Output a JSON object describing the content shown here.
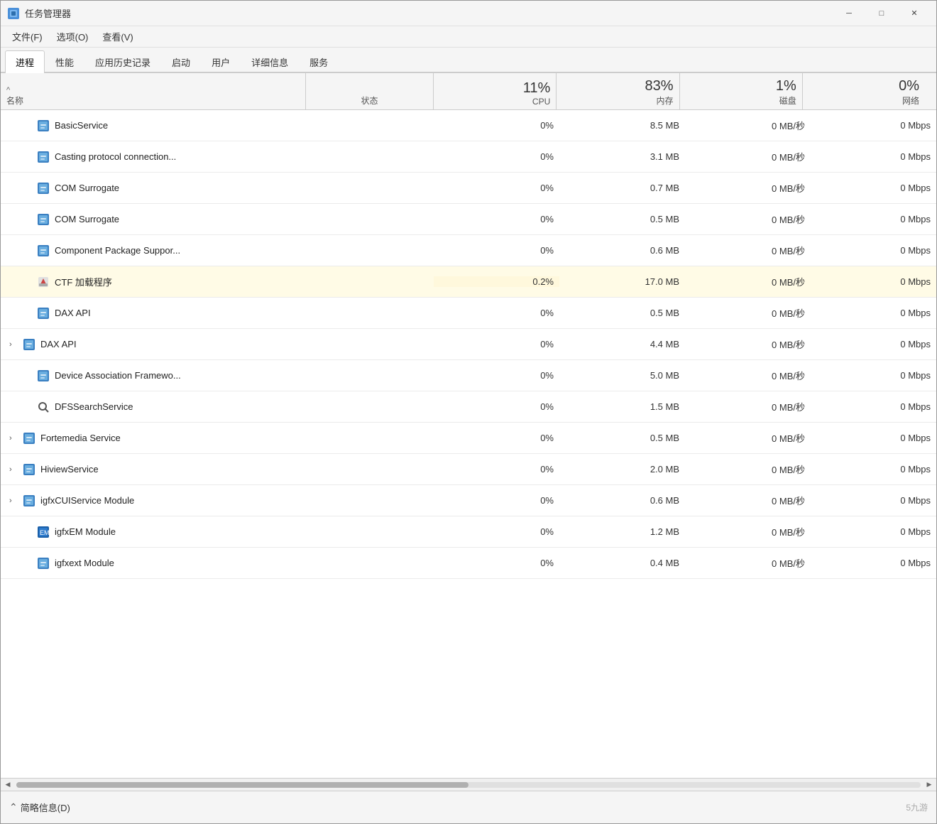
{
  "window": {
    "title": "任务管理器",
    "icon": "⚙"
  },
  "titlebar": {
    "title": "任务管理器",
    "minimize": "─",
    "maximize": "□",
    "close": "✕"
  },
  "menubar": {
    "items": [
      {
        "label": "文件(F)"
      },
      {
        "label": "选项(O)"
      },
      {
        "label": "查看(V)"
      }
    ]
  },
  "tabs": [
    {
      "label": "进程",
      "active": true
    },
    {
      "label": "性能",
      "active": false
    },
    {
      "label": "应用历史记录",
      "active": false
    },
    {
      "label": "启动",
      "active": false
    },
    {
      "label": "用户",
      "active": false
    },
    {
      "label": "详细信息",
      "active": false
    },
    {
      "label": "服务",
      "active": false
    }
  ],
  "table": {
    "headers": {
      "name_sort": "^",
      "name": "名称",
      "status": "状态",
      "cpu_pct": "11%",
      "cpu_label": "CPU",
      "mem_pct": "83%",
      "mem_label": "内存",
      "disk_pct": "1%",
      "disk_label": "磁盘",
      "net_pct": "0%",
      "net_label": "网络"
    },
    "rows": [
      {
        "expandable": false,
        "indent": true,
        "icon": "blue_square",
        "name": "BasicService",
        "status": "",
        "cpu": "0%",
        "mem": "8.5 MB",
        "disk": "0 MB/秒",
        "net": "0 Mbps",
        "highlight": false
      },
      {
        "expandable": false,
        "indent": true,
        "icon": "blue_square",
        "name": "Casting protocol connection...",
        "status": "",
        "cpu": "0%",
        "mem": "3.1 MB",
        "disk": "0 MB/秒",
        "net": "0 Mbps",
        "highlight": false
      },
      {
        "expandable": false,
        "indent": true,
        "icon": "blue_square",
        "name": "COM Surrogate",
        "status": "",
        "cpu": "0%",
        "mem": "0.7 MB",
        "disk": "0 MB/秒",
        "net": "0 Mbps",
        "highlight": false
      },
      {
        "expandable": false,
        "indent": true,
        "icon": "blue_square",
        "name": "COM Surrogate",
        "status": "",
        "cpu": "0%",
        "mem": "0.5 MB",
        "disk": "0 MB/秒",
        "net": "0 Mbps",
        "highlight": false
      },
      {
        "expandable": false,
        "indent": true,
        "icon": "blue_square",
        "name": "Component Package Suppor...",
        "status": "",
        "cpu": "0%",
        "mem": "0.6 MB",
        "disk": "0 MB/秒",
        "net": "0 Mbps",
        "highlight": false
      },
      {
        "expandable": false,
        "indent": true,
        "icon": "pencil",
        "name": "CTF 加载程序",
        "status": "",
        "cpu": "0.2%",
        "mem": "17.0 MB",
        "disk": "0 MB/秒",
        "net": "0 Mbps",
        "highlight": true
      },
      {
        "expandable": false,
        "indent": true,
        "icon": "blue_square",
        "name": "DAX API",
        "status": "",
        "cpu": "0%",
        "mem": "0.5 MB",
        "disk": "0 MB/秒",
        "net": "0 Mbps",
        "highlight": false
      },
      {
        "expandable": true,
        "indent": false,
        "icon": "blue_square",
        "name": "DAX API",
        "status": "",
        "cpu": "0%",
        "mem": "4.4 MB",
        "disk": "0 MB/秒",
        "net": "0 Mbps",
        "highlight": false
      },
      {
        "expandable": false,
        "indent": true,
        "icon": "blue_square",
        "name": "Device Association Framewo...",
        "status": "",
        "cpu": "0%",
        "mem": "5.0 MB",
        "disk": "0 MB/秒",
        "net": "0 Mbps",
        "highlight": false
      },
      {
        "expandable": false,
        "indent": true,
        "icon": "search",
        "name": "DFSSearchService",
        "status": "",
        "cpu": "0%",
        "mem": "1.5 MB",
        "disk": "0 MB/秒",
        "net": "0 Mbps",
        "highlight": false
      },
      {
        "expandable": true,
        "indent": false,
        "icon": "blue_square",
        "name": "Fortemedia Service",
        "status": "",
        "cpu": "0%",
        "mem": "0.5 MB",
        "disk": "0 MB/秒",
        "net": "0 Mbps",
        "highlight": false
      },
      {
        "expandable": true,
        "indent": false,
        "icon": "blue_square",
        "name": "HiviewService",
        "status": "",
        "cpu": "0%",
        "mem": "2.0 MB",
        "disk": "0 MB/秒",
        "net": "0 Mbps",
        "highlight": false
      },
      {
        "expandable": true,
        "indent": false,
        "icon": "blue_square",
        "name": "igfxCUIService Module",
        "status": "",
        "cpu": "0%",
        "mem": "0.6 MB",
        "disk": "0 MB/秒",
        "net": "0 Mbps",
        "highlight": false
      },
      {
        "expandable": false,
        "indent": true,
        "icon": "igfxem",
        "name": "igfxEM Module",
        "status": "",
        "cpu": "0%",
        "mem": "1.2 MB",
        "disk": "0 MB/秒",
        "net": "0 Mbps",
        "highlight": false
      },
      {
        "expandable": false,
        "indent": true,
        "icon": "blue_square",
        "name": "igfxext Module",
        "status": "",
        "cpu": "0%",
        "mem": "0.4 MB",
        "disk": "0 MB/秒",
        "net": "0 Mbps",
        "highlight": false
      }
    ]
  },
  "statusbar": {
    "icon": "⌃",
    "label": "简略信息(D)"
  },
  "watermark": "5九游"
}
